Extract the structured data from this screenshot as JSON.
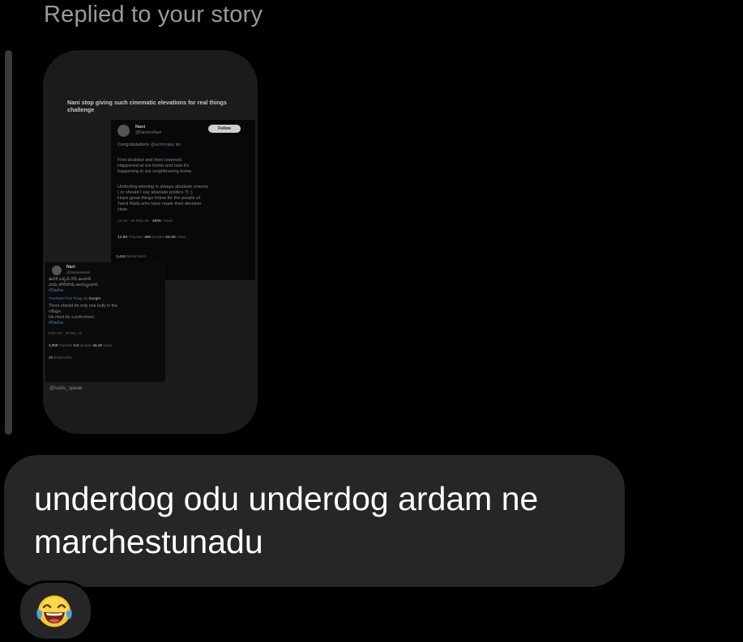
{
  "header": {
    "replied_label": "Replied to your story"
  },
  "story": {
    "caption": "Nani stop giving such cinematic elevations for real things challenge",
    "main_tweet": {
      "name": "Nani",
      "handle": "@NameisNani",
      "follow_label": "Follow",
      "congrats_prefix": "Congratulations ",
      "mention": "@actorvijay",
      "congrats_suffix": " sir.",
      "lines": [
        "First doubted and then crowned.",
        "Happened at our home and now it's",
        "happening in our neighbouring home.",
        "Underdog winning is always absolute cinema",
        "( or should I say absolute politics ?) :)",
        "Hope great things follow for the people of",
        "Tamil Nadu who have made their decision",
        "clear."
      ],
      "meta_time": "12:15 · 04 May 26 · ",
      "meta_views": "493K",
      "meta_views_label": " Views",
      "reposts": "12.8K",
      "reposts_label": " Reposts  ",
      "quotes": "496",
      "quotes_label": " Quotes  ",
      "likes": "53.3K",
      "likes_label": " Likes",
      "bookmarks": "1,442",
      "bookmarks_label": " Bookmarks"
    },
    "inset_tweet": {
      "name": "Nani",
      "handle": "@NameisNani",
      "telugu_line_1": "ఊరికి ఒక్కడే రౌడీ ఉండాలి",
      "telugu_line_2": "వాడు పోలీసోడు అయ్యుండాలి",
      "hashtag_1": "#Dasha",
      "translated_prefix": "Translated from Telugu by ",
      "translated_by": "Google",
      "lines": [
        "There should be only one bully in the",
        "village.",
        "He must be a policeman."
      ],
      "hashtag_2": "#Dasha",
      "meta": "8:56 AM · 26 Dec 19",
      "reposts": "3,359",
      "reposts_label": " Reposts  ",
      "quotes": "113",
      "quotes_label": " Quotes  ",
      "likes": "46.3K",
      "likes_label": " Likes",
      "bookmarks": "15",
      "bookmarks_label": " Bookmarks"
    },
    "watermark": "@subs_speak"
  },
  "message": {
    "text": "underdog odu underdog ardam ne marchestunadu"
  },
  "reaction": {
    "icon": "face-with-tears-of-joy-icon"
  },
  "colors": {
    "background": "#000000",
    "bubble": "#262626",
    "secondary_text": "#9a9a9a",
    "link_blue": "#4a7fb0"
  }
}
